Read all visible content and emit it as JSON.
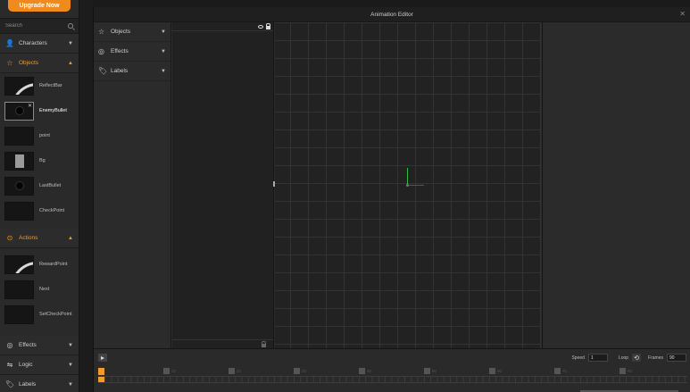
{
  "sidebar": {
    "upgrade_label": "Upgrade Now",
    "search_placeholder": "Search",
    "categories": {
      "characters": {
        "label": "Characters"
      },
      "objects": {
        "label": "Objects"
      },
      "actions": {
        "label": "Actions"
      },
      "effects": {
        "label": "Effects"
      },
      "logic": {
        "label": "Logic"
      },
      "labels": {
        "label": "Labels"
      }
    },
    "objects": [
      {
        "name": "ReflectBar"
      },
      {
        "name": "EnemyBullet"
      },
      {
        "name": "point"
      },
      {
        "name": "Bg"
      },
      {
        "name": "LastBullet"
      },
      {
        "name": "CheckPoint"
      }
    ],
    "actions": [
      {
        "name": "RewardPoint"
      },
      {
        "name": "Next"
      },
      {
        "name": "SetCheckPoint"
      }
    ]
  },
  "editor": {
    "title": "Animation Editor",
    "layer_categories": [
      {
        "label": "Objects"
      },
      {
        "label": "Effects"
      },
      {
        "label": "Labels"
      }
    ],
    "timeline": {
      "speed_label": "Speed",
      "speed_value": "1",
      "loop_label": "Loop",
      "frames_label": "Frames",
      "frames_value": "90",
      "ticks": [
        "10",
        "20",
        "30",
        "40",
        "50",
        "60",
        "70",
        "80"
      ]
    }
  },
  "colors": {
    "accent": "#f39a2a",
    "upgrade": "#f08a1c",
    "axis_y": "#2cbf3a",
    "axis_x": "#c02626"
  }
}
